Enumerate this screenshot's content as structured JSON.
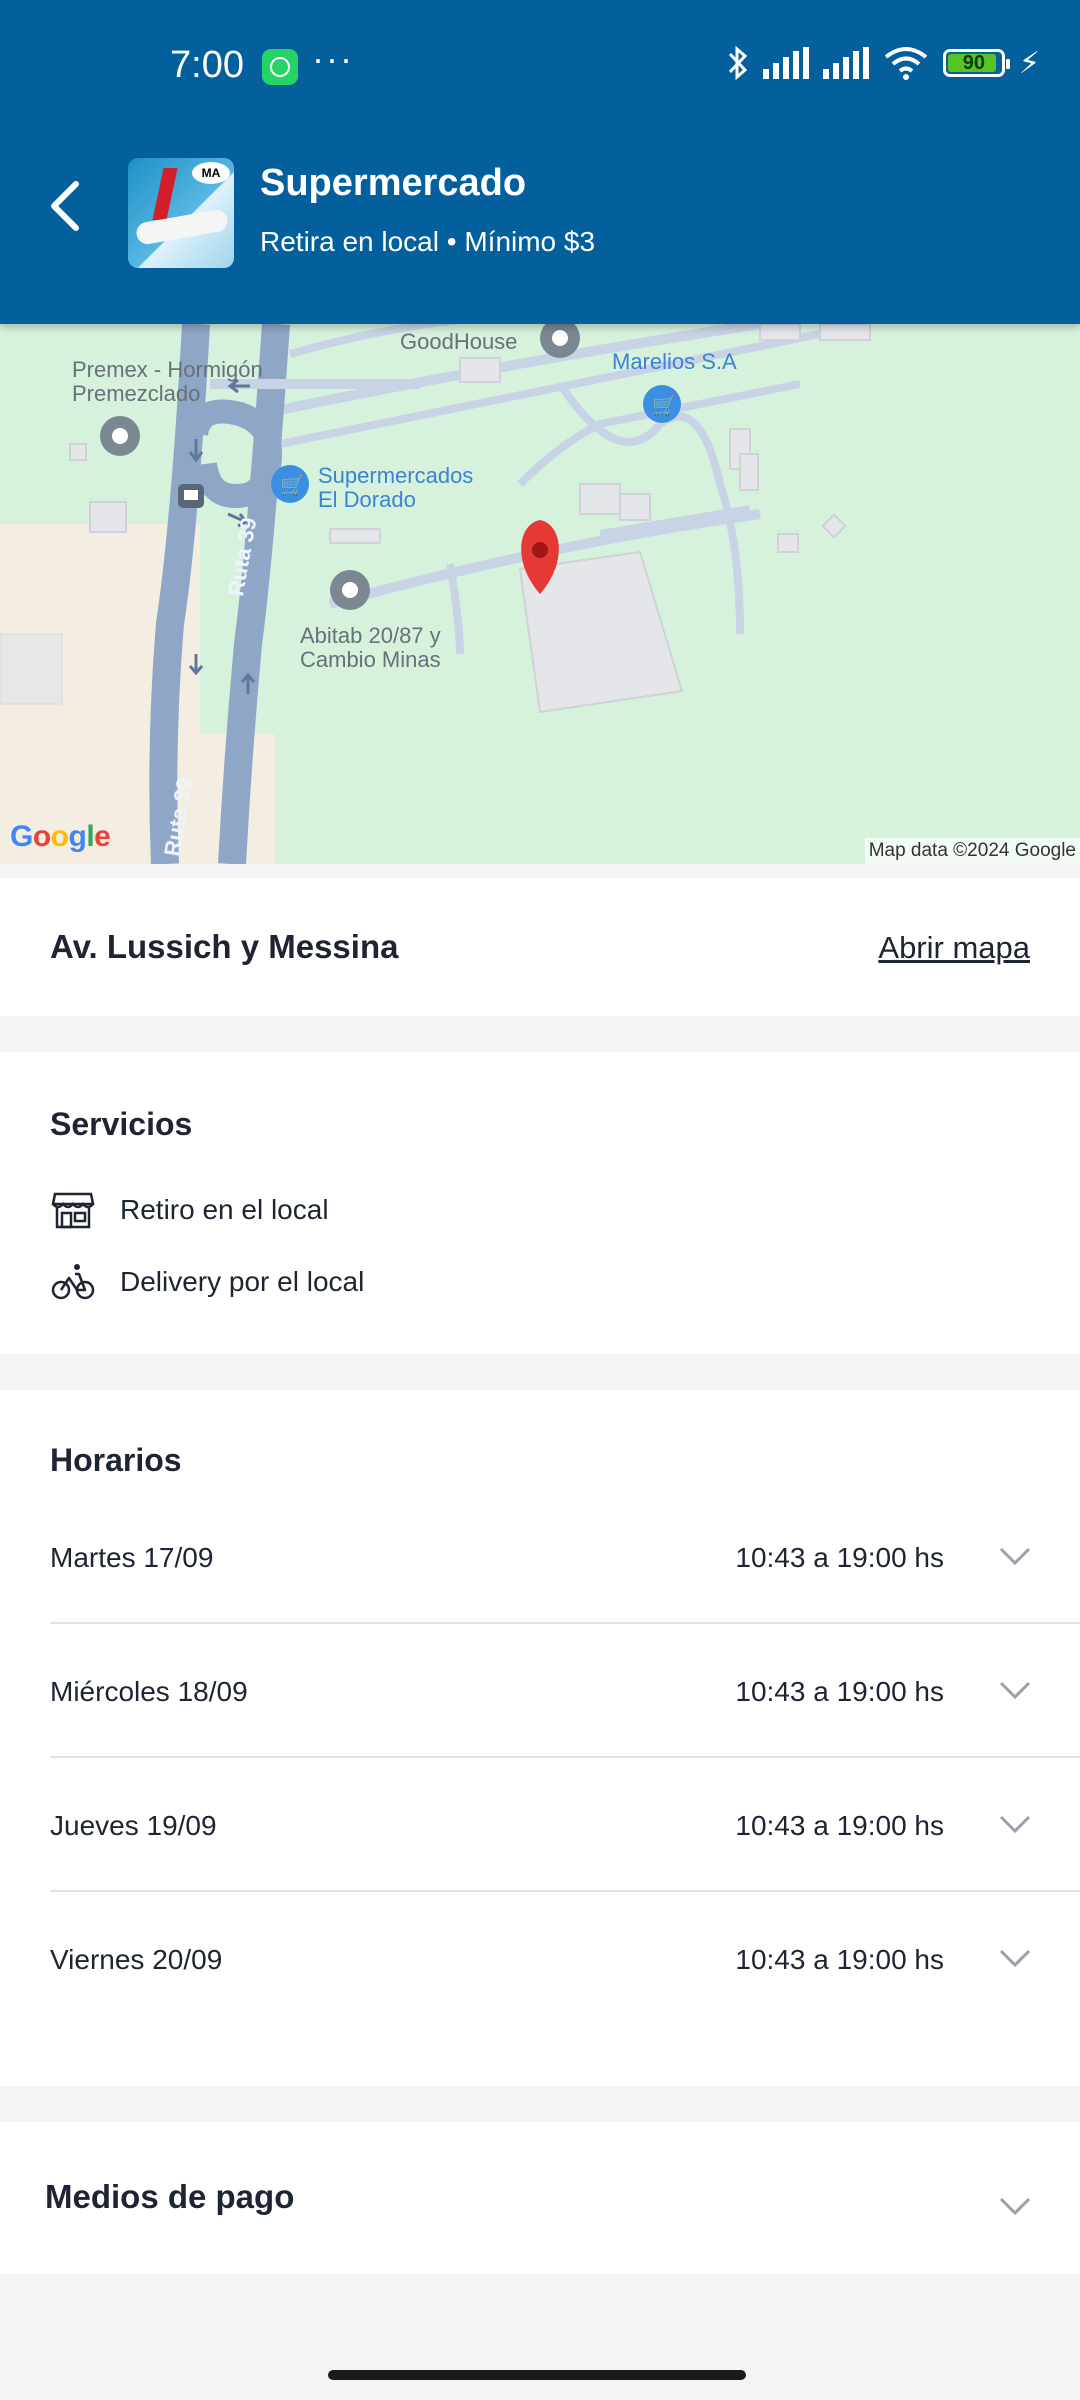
{
  "status_bar": {
    "time": "7:00",
    "more": "···",
    "battery": "90"
  },
  "header": {
    "title": "Supermercado",
    "subtitle": "Retira en local • Mínimo $3",
    "thumb_text": "MA"
  },
  "map": {
    "labels": {
      "premex": "Premex - Hormigón",
      "premex2": "Premezclado",
      "goodhouse": "GoodHouse",
      "marelios": "Marelios S.A",
      "super1": "Supermercados",
      "super2": "El Dorado",
      "abitab1": "Abitab 20/87 y",
      "abitab2": "Cambio Minas",
      "ruta_a": "Ruta 39",
      "ruta_b": "Ruta 39"
    },
    "google": "Google",
    "attribution": "Map data ©2024 Google",
    "colors": {
      "land": "#d6f2dc",
      "road": "#9bb0cc",
      "pin": "#e53935"
    }
  },
  "address": {
    "text": "Av. Lussich y Messina",
    "open_map": "Abrir mapa"
  },
  "services": {
    "title": "Servicios",
    "items": [
      {
        "icon": "store-icon",
        "label": "Retiro en el local"
      },
      {
        "icon": "bicycle-icon",
        "label": "Delivery por el local"
      }
    ]
  },
  "hours": {
    "title": "Horarios",
    "rows": [
      {
        "day": "Martes 17/09",
        "time": "10:43 a 19:00 hs"
      },
      {
        "day": "Miércoles 18/09",
        "time": "10:43 a 19:00 hs"
      },
      {
        "day": "Jueves 19/09",
        "time": "10:43 a 19:00 hs"
      },
      {
        "day": "Viernes 20/09",
        "time": "10:43 a 19:00 hs"
      }
    ]
  },
  "payment": {
    "title": "Medios de pago"
  }
}
